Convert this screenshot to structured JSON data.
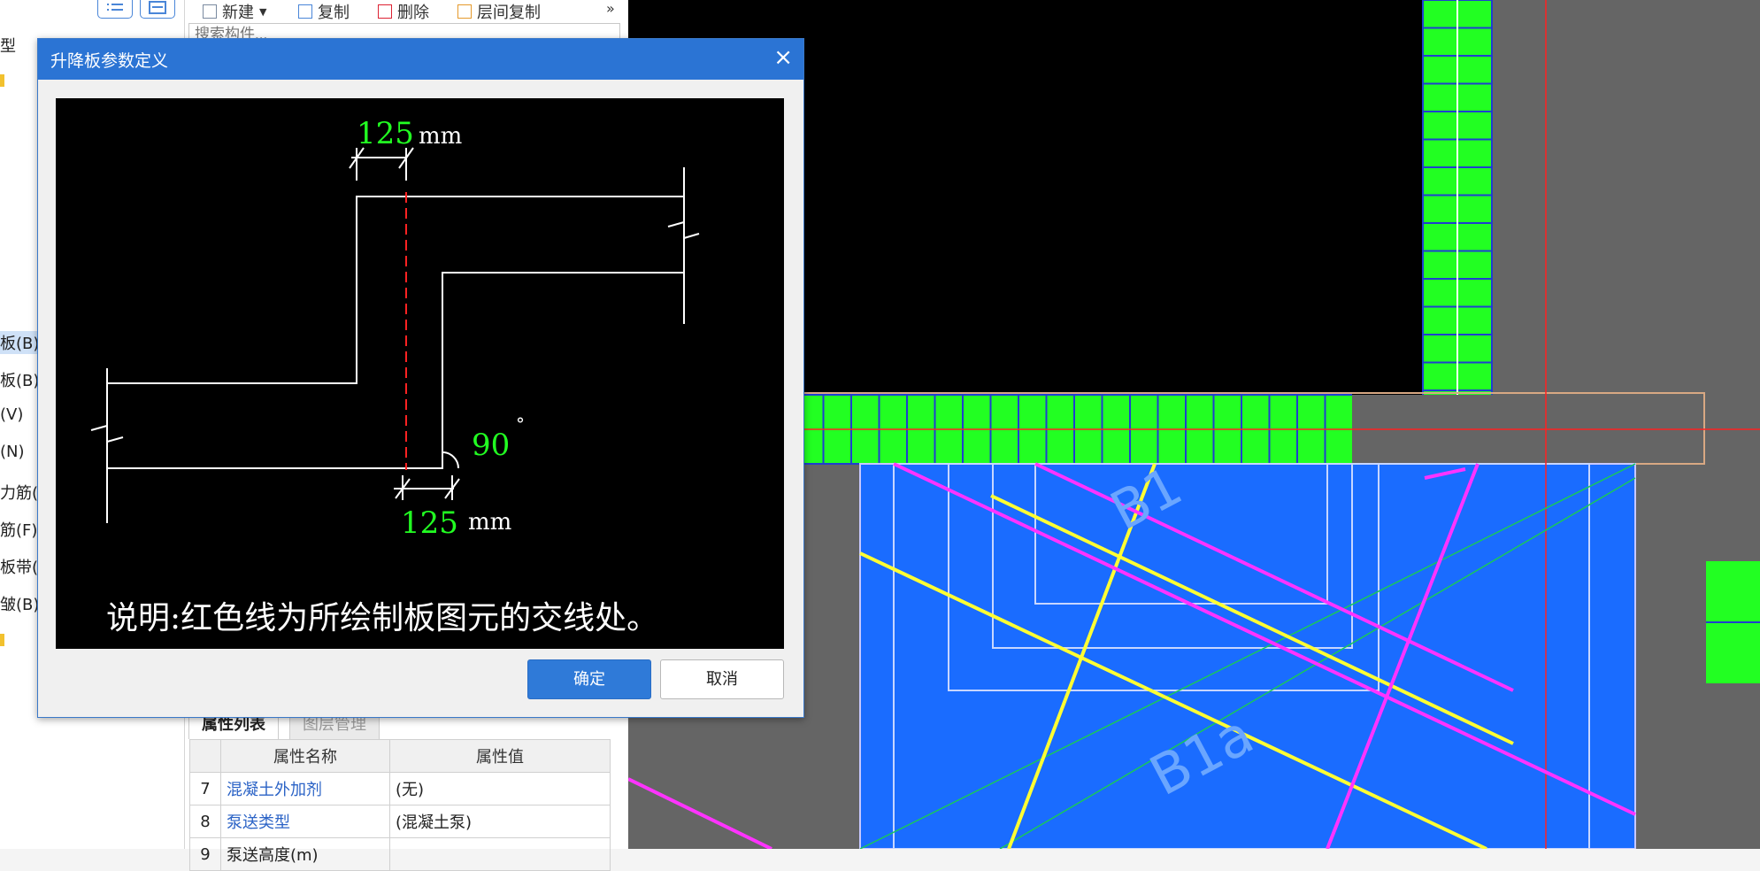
{
  "left_panel": {
    "partial_label": "型",
    "items": [
      {
        "label": "板(B)",
        "selected": true
      },
      {
        "label": "板(B)",
        "selected": false
      },
      {
        "label": "(V)",
        "selected": false
      },
      {
        "label": "(N)",
        "selected": false
      },
      {
        "label": "力筋(",
        "selected": false
      },
      {
        "label": "筋(F)",
        "selected": false
      },
      {
        "label": "板带(",
        "selected": false
      },
      {
        "label": "皱(B)",
        "selected": false
      }
    ]
  },
  "toolbar": {
    "new_label": "新建",
    "copy_label": "复制",
    "delete_label": "删除",
    "floor_copy_label": "层间复制",
    "more": "»"
  },
  "search": {
    "placeholder": "搜索构件..."
  },
  "bottom_tabs": [
    {
      "label": "属性列表",
      "active": true
    },
    {
      "label": "图层管理",
      "active": false
    }
  ],
  "properties": {
    "headers": [
      "属性名称",
      "属性值"
    ],
    "rows": [
      {
        "no": "7",
        "name": "混凝土外加剂",
        "value": "(无)"
      },
      {
        "no": "8",
        "name": "泵送类型",
        "value": "(混凝土泵)"
      },
      {
        "no": "9",
        "name": "泵送高度(m)",
        "value": ""
      }
    ]
  },
  "dialog": {
    "title": "升降板参数定义",
    "close_icon": "close-icon",
    "top_width_value": "125",
    "top_width_unit": "mm",
    "bottom_width_value": "125",
    "bottom_width_unit": "mm",
    "angle_value": "90",
    "angle_unit": "°",
    "note": "说明:红色线为所绘制板图元的交线处。",
    "ok_label": "确定",
    "cancel_label": "取消"
  },
  "cad": {
    "labels": [
      "B1",
      "B1a"
    ],
    "colors": {
      "background": "#656565",
      "black_area": "#000000",
      "slab_fill": "#1a6cff",
      "grid_green": "#22ff22",
      "magenta_rebar": "#ff33ff",
      "yellow_rebar": "#ffff33",
      "red_axis": "#ff2222"
    }
  }
}
